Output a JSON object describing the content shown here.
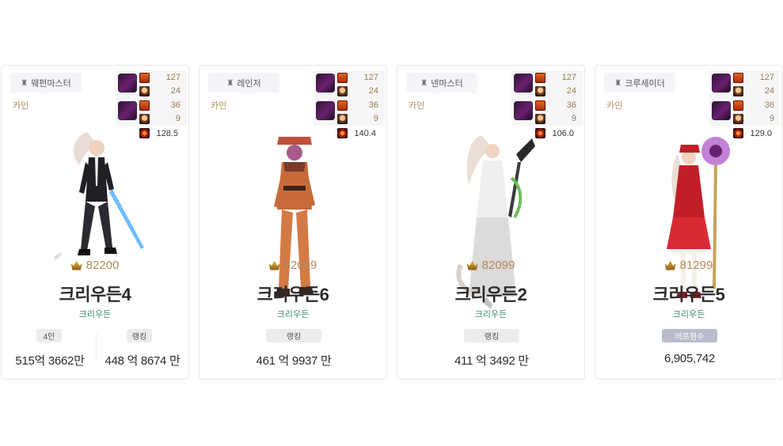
{
  "cards": [
    {
      "job": "웨펀마스터",
      "server": "카인",
      "stats": [
        "127",
        "24",
        "36",
        "9"
      ],
      "power": "128.5",
      "score": "82200",
      "name": "크리우든4",
      "adventure": "크리우든",
      "left_pill": "4인",
      "left_amount": "515억 3662만",
      "right_pill": "랭킹",
      "right_amount": "448 억 8674 만"
    },
    {
      "job": "레인저",
      "server": "카인",
      "stats": [
        "127",
        "24",
        "36",
        "9"
      ],
      "power": "140.4",
      "score": "82099",
      "name": "크리우든6",
      "adventure": "크리우든",
      "pill": "랭킹",
      "amount": "461 억 9937 만"
    },
    {
      "job": "넨마스터",
      "server": "카인",
      "stats": [
        "127",
        "24",
        "36",
        "9"
      ],
      "power": "106.0",
      "score": "82099",
      "name": "크리우든2",
      "adventure": "크리우든",
      "pill": "랭킹",
      "amount": "411 억 3492 만"
    },
    {
      "job": "크루세이더",
      "server": "카인",
      "stats": [
        "127",
        "24",
        "36",
        "9"
      ],
      "power": "129.0",
      "score": "81299",
      "name": "크리우든5",
      "adventure": "크리우든",
      "pill": "버프점수",
      "amount": "6,905,742"
    }
  ]
}
